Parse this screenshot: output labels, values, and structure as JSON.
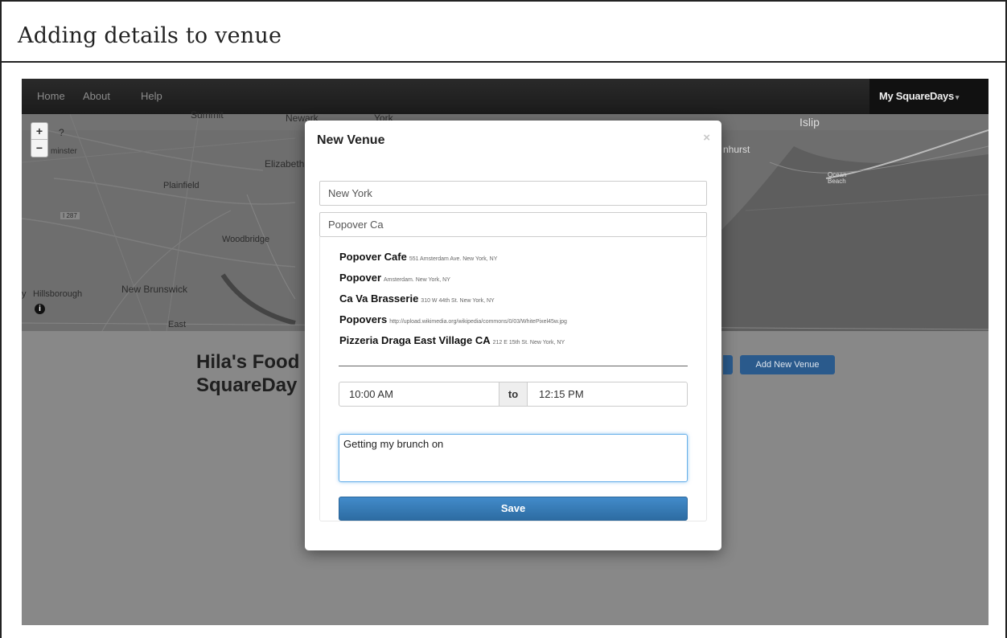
{
  "frame": {
    "title": "Adding details to venue"
  },
  "navbar": {
    "links": [
      "Home",
      "About",
      "Help"
    ],
    "user_menu": "My SquareDays",
    "caret": "▾"
  },
  "map": {
    "zoom_in": "+",
    "zoom_out": "−",
    "info": "i",
    "labels": {
      "summit": "Summit",
      "newark": "Newark",
      "york": "York",
      "islip": "Islip",
      "question": "?",
      "minster": "minster",
      "elizabeth": "Elizabeth",
      "nhurst": "nhurst",
      "plainfield": "Plainfield",
      "i287": "I 287",
      "woodbridge": "Woodbridge",
      "hillsborough": "Hillsborough",
      "y": "y",
      "new_brunswick": "New Brunswick",
      "east": "East",
      "ocean_beach": "Ocean Beach"
    }
  },
  "page": {
    "heading_line1": "Hila's Food",
    "heading_line2": "SquareDay",
    "add_venue_button": "Add New Venue"
  },
  "modal": {
    "title": "New Venue",
    "close": "×",
    "city_value": "New York",
    "venue_query": "Popover Ca",
    "suggestions": [
      {
        "name": "Popover Cafe",
        "address": "551 Amsterdam Ave. New York, NY"
      },
      {
        "name": "Popover",
        "address": "Amsterdam. New York, NY"
      },
      {
        "name": "Ca Va Brasserie",
        "address": "310 W 44th St. New York, NY"
      },
      {
        "name": "Popovers",
        "address": "http://upload.wikimedia.org/wikipedia/commons/0/03/WhitePixel45w.jpg"
      },
      {
        "name": "Pizzeria Draga East Village CA",
        "address": "212 E 15th St. New York, NY"
      }
    ],
    "time_start": "10:00 AM",
    "time_to": "to",
    "time_end": "12:15 PM",
    "note": "Getting my brunch on",
    "save_label": "Save"
  },
  "colors": {
    "navbar": "#1b1b1b",
    "map": "#6b6b6b",
    "overlay": "#888888",
    "primary": "#428bca",
    "focus": "#66afe9"
  }
}
